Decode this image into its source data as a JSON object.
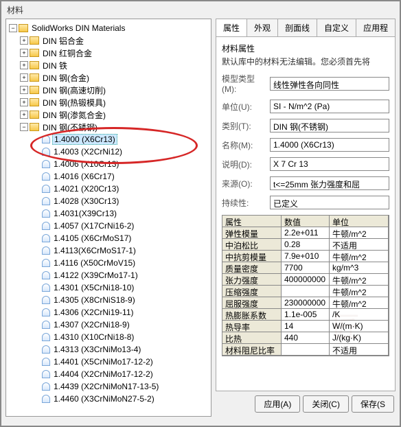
{
  "title": "材料",
  "tree": {
    "root": "SolidWorks DIN Materials",
    "categories": [
      "DIN 铝合金",
      "DIN 红铜合金",
      "DIN 铁",
      "DIN 钢(合金)",
      "DIN 钢(高速切削)",
      "DIN 钢(热锻模具)",
      "DIN 钢(渗氮合金)",
      "DIN 钢(不锈钢)"
    ],
    "steels": [
      "1.4000 (X6Cr13)",
      "1.4003 (X2CrNi12)",
      "1.4006 (X10Cr13)",
      "1.4016 (X6Cr17)",
      "1.4021 (X20Cr13)",
      "1.4028 (X30Cr13)",
      "1.4031(X39Cr13)",
      "1.4057 (X17CrNi16-2)",
      "1.4105 (X6CrMoS17)",
      "1.4113(X6CrMoS17-1)",
      "1.4116 (X50CrMoV15)",
      "1.4122 (X39CrMo17-1)",
      "1.4301 (X5CrNi18-10)",
      "1.4305 (X8CrNiS18-9)",
      "1.4306 (X2CrNi19-11)",
      "1.4307 (X2CrNi18-9)",
      "1.4310 (X10CrNi18-8)",
      "1.4313 (X3CrNiMo13-4)",
      "1.4401 (X5CrNiMo17-12-2)",
      "1.4404 (X2CrNiMo17-12-2)",
      "1.4439 (X2CrNiMoN17-13-5)",
      "1.4460 (X3CrNiMoN27-5-2)"
    ]
  },
  "tabs": [
    "属性",
    "外观",
    "剖面线",
    "自定义",
    "应用程"
  ],
  "panel": {
    "heading": "材料属性",
    "note": "默认库中的材料无法编辑。您必须首先将",
    "rows": {
      "modelType": {
        "label": "模型类型(M):",
        "value": "线性弹性各向同性"
      },
      "unit": {
        "label": "单位(U):",
        "value": "SI - N/m^2 (Pa)"
      },
      "category": {
        "label": "类别(T):",
        "value": "DIN 钢(不锈钢)"
      },
      "name": {
        "label": "名称(M):",
        "value": "1.4000 (X6Cr13)"
      },
      "desc": {
        "label": "说明(D):",
        "value": "X 7 Cr 13"
      },
      "source": {
        "label": "来源(O):",
        "value": "t<=25mm 张力强度和屈"
      },
      "persist": {
        "label": "持续性:",
        "value": "已定义"
      }
    }
  },
  "grid": {
    "headers": [
      "属性",
      "数值",
      "单位"
    ],
    "rows": [
      [
        "弹性模量",
        "2.2e+011",
        "牛顿/m^2"
      ],
      [
        "中泊松比",
        "0.28",
        "不适用"
      ],
      [
        "中抗剪模量",
        "7.9e+010",
        "牛顿/m^2"
      ],
      [
        "质量密度",
        "7700",
        "kg/m^3"
      ],
      [
        "张力强度",
        "400000000",
        "牛顿/m^2"
      ],
      [
        "压缩强度",
        "",
        "牛顿/m^2"
      ],
      [
        "屈服强度",
        "230000000",
        "牛顿/m^2"
      ],
      [
        "热膨胀系数",
        "1.1e-005",
        "/K"
      ],
      [
        "热导率",
        "14",
        "W/(m·K)"
      ],
      [
        "比热",
        "440",
        "J/(kg·K)"
      ],
      [
        "材料阻尼比率",
        "",
        "不适用"
      ]
    ]
  },
  "buttons": {
    "apply": "应用(A)",
    "close": "关闭(C)",
    "save": "保存(S"
  }
}
